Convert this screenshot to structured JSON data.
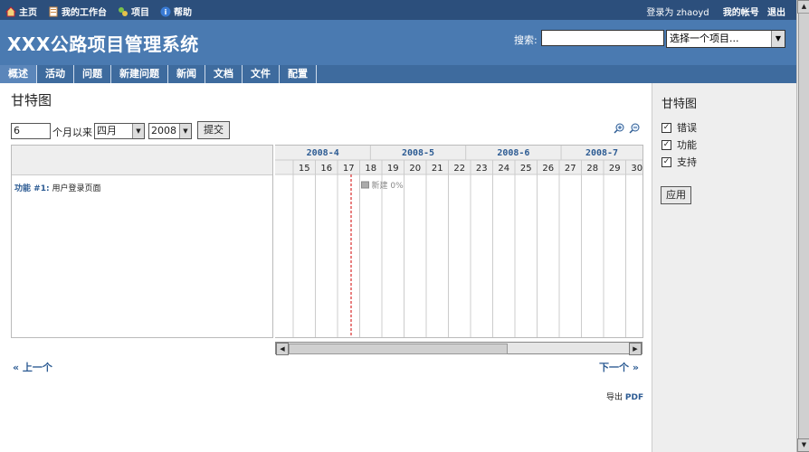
{
  "topnav": {
    "home": "主页",
    "my_page": "我的工作台",
    "projects": "项目",
    "help": "帮助",
    "logged_in_as": "登录为 zhaoyd",
    "my_account": "我的帐号",
    "logout": "退出"
  },
  "header": {
    "title": "XXX公路项目管理系统",
    "search_label": "搜索:",
    "search_value": "",
    "project_select": "选择一个项目..."
  },
  "tabs": [
    "概述",
    "活动",
    "问题",
    "新建问题",
    "新闻",
    "文档",
    "文件",
    "配置"
  ],
  "active_tab": 0,
  "page_title": "甘特图",
  "controls": {
    "months_value": "6",
    "months_label": "个月以来",
    "month_select": "四月",
    "year_select": "2008",
    "submit": "提交"
  },
  "gantt": {
    "months": [
      "2008-4",
      "2008-5",
      "2008-6",
      "2008-7"
    ],
    "weeks": [
      "15",
      "16",
      "17",
      "18",
      "19",
      "20",
      "21",
      "22",
      "23",
      "24",
      "25",
      "26",
      "27",
      "28",
      "29",
      "30"
    ],
    "issue": {
      "tracker": "功能",
      "id": "#1:",
      "subject": "用户登录页面",
      "status_label": "新建 0%"
    }
  },
  "pager": {
    "prev": "« 上一个",
    "next": "下一个 »"
  },
  "export": {
    "label": "导出",
    "pdf": "PDF"
  },
  "sidebar": {
    "title": "甘特图",
    "trackers": [
      "错误",
      "功能",
      "支持"
    ],
    "apply": "应用"
  },
  "colors": {
    "topbar": "#2c4f7c",
    "header": "#4a7ab1",
    "menu": "#3e6b9e",
    "link": "#2c5b93",
    "today_line": "#d00000"
  }
}
